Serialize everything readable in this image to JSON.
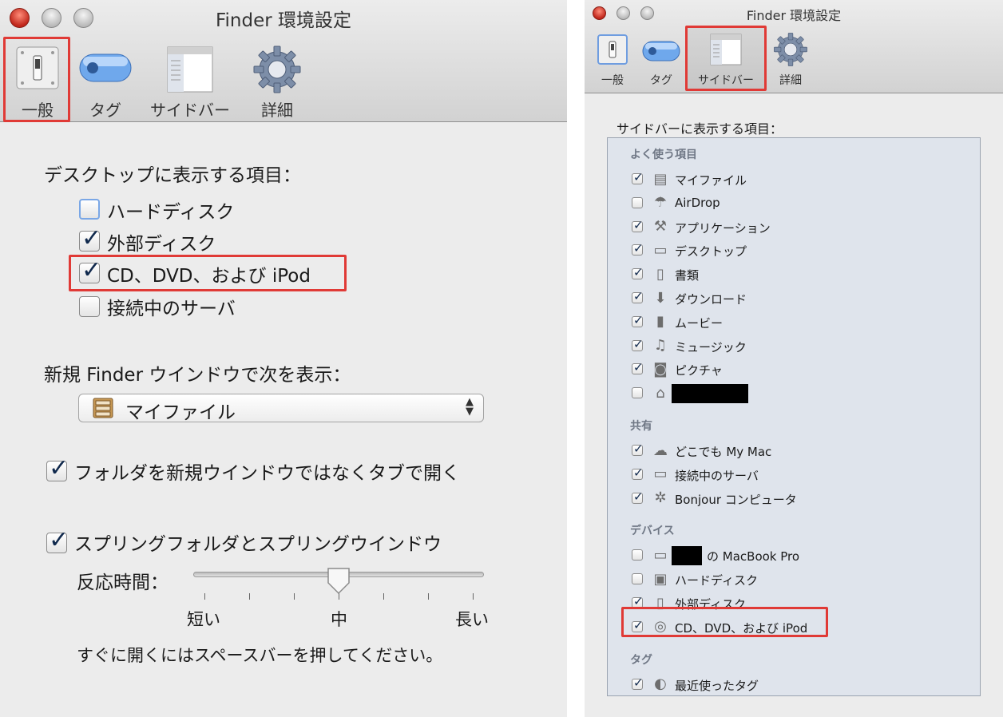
{
  "left": {
    "title": "Finder 環境設定",
    "toolbar": {
      "general": "一般",
      "tags": "タグ",
      "sidebar": "サイドバー",
      "advanced": "詳細"
    },
    "desktop_heading": "デスクトップに表示する項目：",
    "desktop_items": [
      {
        "label": "ハードディスク",
        "checked": false
      },
      {
        "label": "外部ディスク",
        "checked": true
      },
      {
        "label": "CD、DVD、および iPod",
        "checked": true
      },
      {
        "label": "接続中のサーバ",
        "checked": false
      }
    ],
    "new_window_heading": "新規 Finder ウインドウで次を表示：",
    "new_window_value": "マイファイル",
    "open_in_tabs": {
      "label": "フォルダを新規ウインドウではなくタブで開く",
      "checked": true
    },
    "spring_loaded": {
      "label": "スプリングフォルダとスプリングウインドウ",
      "checked": true
    },
    "delay_label": "反応時間：",
    "delay_level_fraction": 0.5,
    "slider_ticks": {
      "short": "短い",
      "medium": "中",
      "long": "長い"
    },
    "space_hint": "すぐに開くにはスペースバーを押してください。"
  },
  "right": {
    "title": "Finder 環境設定",
    "toolbar": {
      "general": "一般",
      "tags": "タグ",
      "sidebar": "サイドバー",
      "advanced": "詳細"
    },
    "heading": "サイドバーに表示する項目：",
    "sections": {
      "favorites": {
        "title": "よく使う項目",
        "items": [
          {
            "label": "マイファイル",
            "checked": true,
            "icon": "all-files-icon"
          },
          {
            "label": "AirDrop",
            "checked": false,
            "icon": "airdrop-icon"
          },
          {
            "label": "アプリケーション",
            "checked": true,
            "icon": "applications-icon"
          },
          {
            "label": "デスクトップ",
            "checked": true,
            "icon": "desktop-icon"
          },
          {
            "label": "書類",
            "checked": true,
            "icon": "documents-icon"
          },
          {
            "label": "ダウンロード",
            "checked": true,
            "icon": "downloads-icon"
          },
          {
            "label": "ムービー",
            "checked": true,
            "icon": "movies-icon"
          },
          {
            "label": "ミュージック",
            "checked": true,
            "icon": "music-icon"
          },
          {
            "label": "ピクチャ",
            "checked": true,
            "icon": "pictures-icon"
          },
          {
            "label": "",
            "checked": false,
            "icon": "home-icon"
          }
        ]
      },
      "shared": {
        "title": "共有",
        "items": [
          {
            "label": "どこでも My Mac",
            "checked": true,
            "icon": "cloud-icon"
          },
          {
            "label": "接続中のサーバ",
            "checked": true,
            "icon": "server-icon"
          },
          {
            "label": "Bonjour コンピュータ",
            "checked": true,
            "icon": "bonjour-icon"
          }
        ]
      },
      "devices": {
        "title": "デバイス",
        "items": [
          {
            "label": "の MacBook Pro",
            "checked": false,
            "icon": "laptop-icon"
          },
          {
            "label": "ハードディスク",
            "checked": false,
            "icon": "hard-disk-icon"
          },
          {
            "label": "外部ディスク",
            "checked": true,
            "icon": "external-disk-icon"
          },
          {
            "label": "CD、DVD、および iPod",
            "checked": true,
            "icon": "optical-disc-icon"
          }
        ]
      },
      "tags": {
        "title": "タグ",
        "items": [
          {
            "label": "最近使ったタグ",
            "checked": true,
            "icon": "tag-icon"
          }
        ]
      }
    }
  },
  "colors": {
    "highlight": "#e03a36",
    "checkbox_focus": "#7aa7e6",
    "list_background": "#dfe4ec"
  }
}
